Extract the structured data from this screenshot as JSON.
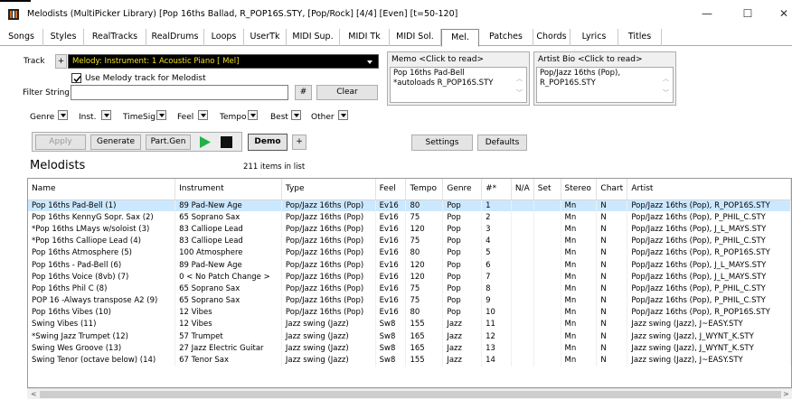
{
  "window": {
    "title": "Melodists  (MultiPicker Library)  [Pop 16ths Ballad, R_POP16S.STY,  [Pop/Rock] [4/4] [Even] [t=50-120]",
    "minimize": "—",
    "maximize": "☐",
    "close": "✕"
  },
  "tabs": [
    "Songs",
    "Styles",
    "RealTracks",
    "RealDrums",
    "Loops",
    "UserTk",
    "MIDI Sup.",
    "MIDI Tk",
    "MIDI Sol.",
    "Mel.",
    "Patches",
    "Chords",
    "Lyrics",
    "Titles"
  ],
  "active_tab": "Mel.",
  "track": {
    "label": "Track",
    "plus": "+",
    "value": "Melody: Instrument: 1 Acoustic Piano [ Mel]",
    "use_melody_label": "Use Melody track for Melodist",
    "use_melody_checked": true
  },
  "filter": {
    "label": "Filter String",
    "value": "",
    "hash_button": "#",
    "clear_button": "Clear"
  },
  "memo": {
    "title": "Memo   <Click to read>",
    "text": "Pop 16ths Pad-Bell\n*autoloads R_POP16S.STY"
  },
  "artist_bio": {
    "title": "Artist Bio   <Click to read>",
    "text": "Pop/Jazz 16ths (Pop),\nR_POP16S.STY"
  },
  "filters": [
    "Genre",
    "Inst.",
    "TimeSig",
    "Feel",
    "Tempo",
    "Best",
    "Other"
  ],
  "actions": {
    "apply": "Apply",
    "generate": "Generate",
    "partgen": "Part.Gen",
    "demo": "Demo",
    "plus": "+",
    "settings": "Settings",
    "defaults": "Defaults"
  },
  "list": {
    "heading": "Melodists",
    "count": "211 items in list",
    "columns": [
      "Name",
      "Instrument",
      "Type",
      "Feel",
      "Tempo",
      "Genre",
      "#*",
      "N/A",
      "Set",
      "Stereo",
      "Chart",
      "Artist"
    ],
    "rows": [
      [
        "Pop 16ths Pad-Bell  (1)",
        "89 Pad-New Age",
        "Pop/Jazz 16ths (Pop)",
        "Ev16",
        "80",
        "Pop",
        "1",
        "",
        "",
        "Mn",
        "N",
        "Pop/Jazz 16ths (Pop), R_POP16S.STY"
      ],
      [
        "Pop 16ths KennyG Sopr. Sax  (2)",
        "65 Soprano Sax",
        "Pop/Jazz 16ths (Pop)",
        "Ev16",
        "75",
        "Pop",
        "2",
        "",
        "",
        "Mn",
        "N",
        "Pop/Jazz 16ths (Pop), P_PHIL_C.STY"
      ],
      [
        "*Pop 16ths LMays w/soloist  (3)",
        "83 Calliope Lead",
        "Pop/Jazz 16ths (Pop)",
        "Ev16",
        "120",
        "Pop",
        "3",
        "",
        "",
        "Mn",
        "N",
        "Pop/Jazz 16ths (Pop), J_L_MAYS.STY"
      ],
      [
        "*Pop 16ths Calliope Lead  (4)",
        "83 Calliope Lead",
        "Pop/Jazz 16ths (Pop)",
        "Ev16",
        "75",
        "Pop",
        "4",
        "",
        "",
        "Mn",
        "N",
        "Pop/Jazz 16ths (Pop), P_PHIL_C.STY"
      ],
      [
        "Pop 16ths Atmosphere  (5)",
        "100 Atmosphere",
        "Pop/Jazz 16ths (Pop)",
        "Ev16",
        "80",
        "Pop",
        "5",
        "",
        "",
        "Mn",
        "N",
        "Pop/Jazz 16ths (Pop), R_POP16S.STY"
      ],
      [
        "Pop 16ths - Pad-Bell  (6)",
        "89 Pad-New Age",
        "Pop/Jazz 16ths (Pop)",
        "Ev16",
        "120",
        "Pop",
        "6",
        "",
        "",
        "Mn",
        "N",
        "Pop/Jazz 16ths (Pop), J_L_MAYS.STY"
      ],
      [
        "Pop 16ths Voice (8vb)  (7)",
        "0 < No Patch Change >",
        "Pop/Jazz 16ths (Pop)",
        "Ev16",
        "120",
        "Pop",
        "7",
        "",
        "",
        "Mn",
        "N",
        "Pop/Jazz 16ths (Pop), J_L_MAYS.STY"
      ],
      [
        "Pop 16ths Phil C  (8)",
        "65 Soprano Sax",
        "Pop/Jazz 16ths (Pop)",
        "Ev16",
        "75",
        "Pop",
        "8",
        "",
        "",
        "Mn",
        "N",
        "Pop/Jazz 16ths (Pop), P_PHIL_C.STY"
      ],
      [
        "POP 16 -Always transpose A2  (9)",
        "65 Soprano Sax",
        "Pop/Jazz 16ths (Pop)",
        "Ev16",
        "75",
        "Pop",
        "9",
        "",
        "",
        "Mn",
        "N",
        "Pop/Jazz 16ths (Pop), P_PHIL_C.STY"
      ],
      [
        "Pop 16ths Vibes  (10)",
        "12 Vibes",
        "Pop/Jazz 16ths (Pop)",
        "Ev16",
        "80",
        "Pop",
        "10",
        "",
        "",
        "Mn",
        "N",
        "Pop/Jazz 16ths (Pop), R_POP16S.STY"
      ],
      [
        "Swing Vibes  (11)",
        "12 Vibes",
        "Jazz  swing (Jazz)",
        "Sw8",
        "155",
        "Jazz",
        "11",
        "",
        "",
        "Mn",
        "N",
        "Jazz  swing (Jazz), J~EASY.STY"
      ],
      [
        "*Swing Jazz Trumpet  (12)",
        "57 Trumpet",
        "Jazz  swing (Jazz)",
        "Sw8",
        "165",
        "Jazz",
        "12",
        "",
        "",
        "Mn",
        "N",
        "Jazz  swing (Jazz), J_WYNT_K.STY"
      ],
      [
        "Swing Wes Groove  (13)",
        "27 Jazz Electric Guitar",
        "Jazz  swing (Jazz)",
        "Sw8",
        "165",
        "Jazz",
        "13",
        "",
        "",
        "Mn",
        "N",
        "Jazz  swing (Jazz), J_WYNT_K.STY"
      ],
      [
        "Swing Tenor (octave below)  (14)",
        "67 Tenor Sax",
        "Jazz  swing (Jazz)",
        "Sw8",
        "155",
        "Jazz",
        "14",
        "",
        "",
        "Mn",
        "N",
        "Jazz  swing (Jazz), J~EASY.STY"
      ]
    ],
    "selected_row": 0
  },
  "colors": {
    "selected_row": "#cce8ff",
    "track_bg": "#000000",
    "track_text": "#f2e020",
    "play_green": "#22b14c"
  }
}
